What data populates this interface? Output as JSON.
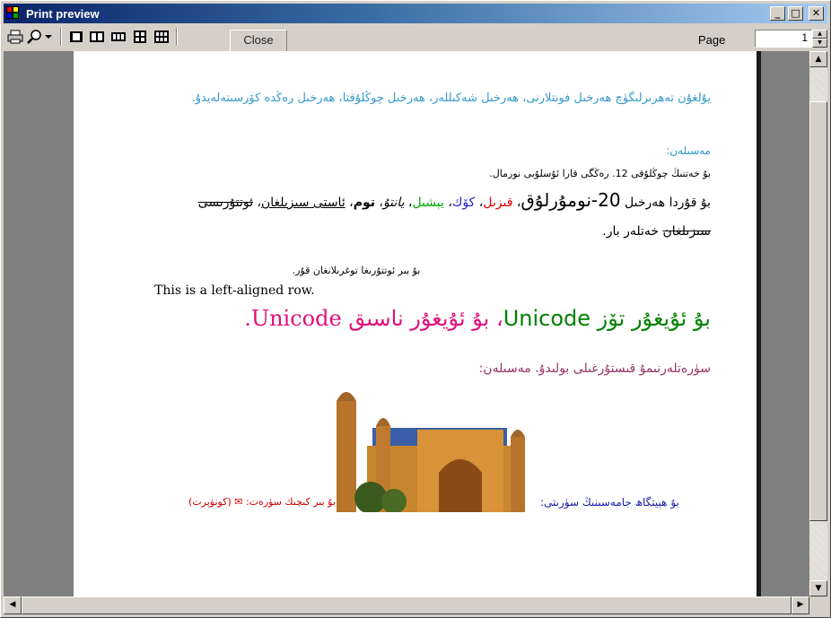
{
  "window": {
    "title": "Print preview",
    "buttons": {
      "minimize": "_",
      "maximize": "□",
      "close": "✕"
    }
  },
  "toolbar": {
    "close_label": "Close",
    "page_label": "Page",
    "page_value": "1",
    "icons": [
      "print-icon",
      "zoom-icon",
      "dropdown-arrow-icon",
      "one-page-icon",
      "two-pages-icon",
      "three-pages-icon",
      "four-pages-icon",
      "six-pages-icon"
    ]
  },
  "document": {
    "para1": "يۇلغۇن تەھرىرلىگۈچ ھەرخىل فونتلارنى، ھەرخىل شەكىللەر، ھەرخىل چوڭلۇقتا، ھەرخىل رەڭدە كۆرسىتەلەيدۇ.",
    "para2": "مەسىلەن:",
    "para3": "بۇ خەتنىڭ چوڭلۇقى 12. رەڭگى قارا ئۇسلۇبى نورمال.",
    "para4": {
      "a": "بۇ قۇردا ھەرخىل ",
      "big": "20-نومۇرلۇق",
      "b": "، ",
      "red": "قىزىل",
      "c": "، ",
      "blue": "كۆك",
      "d": "، ",
      "green": "يېشىل",
      "e": "، ",
      "ital": "يانتۇ",
      "f": "، ",
      "bold": "توم",
      "g": "، ",
      "under": "ئاستى سىزىلغان",
      "h": "، ",
      "strike": "ئوتتۇرىسى سىزىلغان",
      "i": " خەتلەر بار."
    },
    "para5": "بۇ بىر ئوتتۇرىغا توغرىلانغان قۇر.",
    "para6": "This is a left-aligned row.",
    "para7": {
      "green": "بۇ ئۇيغۇر تۆز Unicode",
      "pink": "، بۇ ئۇيغۇر ناسىق Unicode."
    },
    "para8": "سۈرەتلەرنىمۇ قىستۇرغىلى بولىدۇ. مەسىلەن:",
    "caption_blue": "بۇ ھېيتگاھ جامەسىنىڭ سۈرىتى:",
    "caption_red": "بۇ بىر كىچىك سۈرەت: ✉ (كونۋېرت)"
  }
}
